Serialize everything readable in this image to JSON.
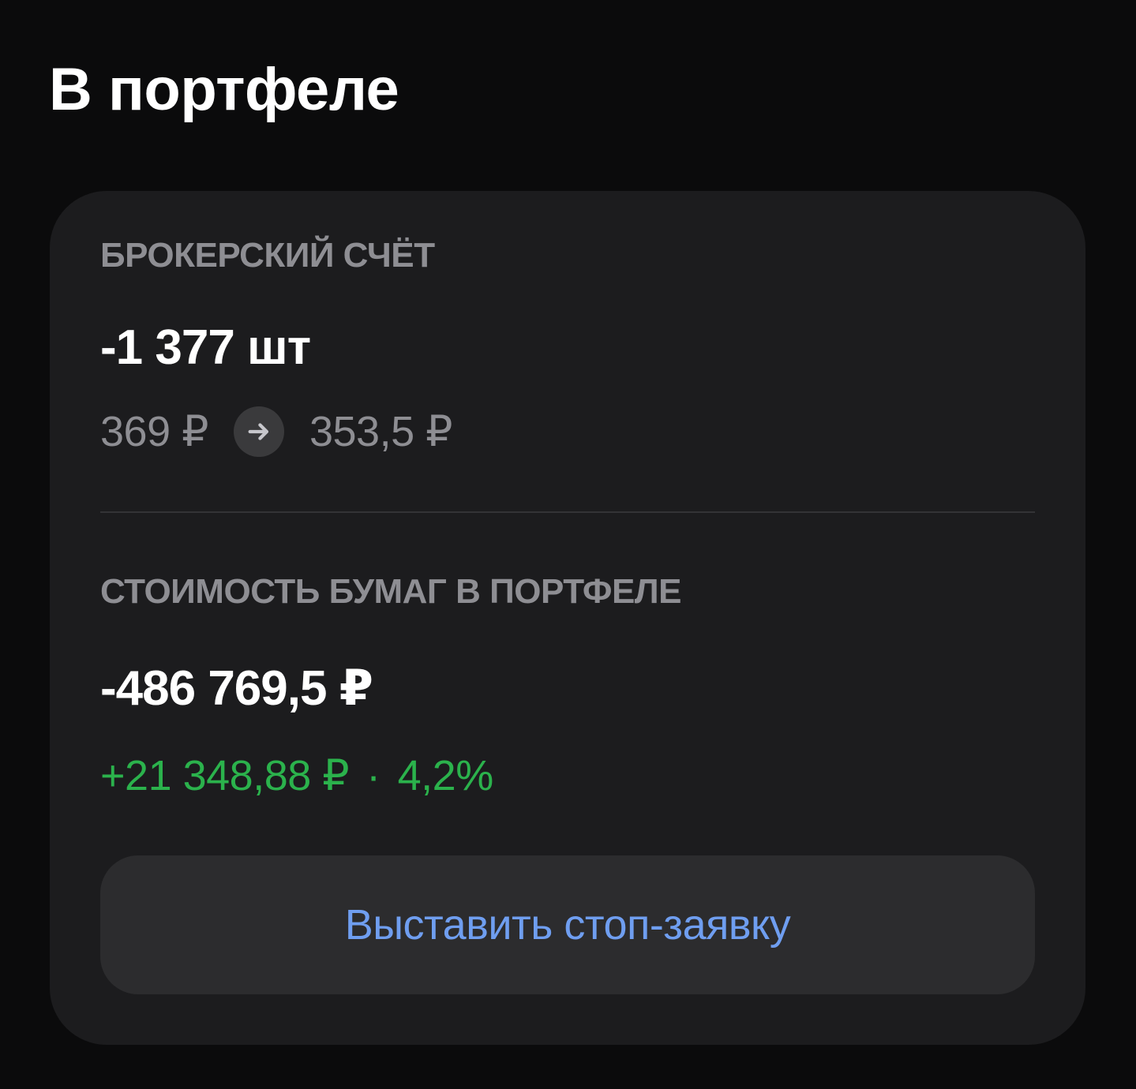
{
  "header": {
    "title": "В портфеле"
  },
  "card": {
    "account_label": "БРОКЕРСКИЙ СЧЁТ",
    "quantity": "-1 377 шт",
    "price_from": "369 ₽",
    "price_to": "353,5 ₽",
    "arrow_icon": "arrow-right-icon",
    "value_label": "СТОИМОСТЬ БУМАГ В ПОРТФЕЛЕ",
    "value_total": "-486 769,5 ₽",
    "pnl_amount": "+21 348,88 ₽",
    "pnl_separator": "·",
    "pnl_percent": "4,2%",
    "stop_button_label": "Выставить стоп-заявку"
  },
  "colors": {
    "background": "#0b0b0c",
    "card": "#1c1c1e",
    "muted_text": "#8e8e93",
    "positive": "#2bb24c",
    "link": "#6f9ef0",
    "button_bg": "#2c2c2e"
  }
}
